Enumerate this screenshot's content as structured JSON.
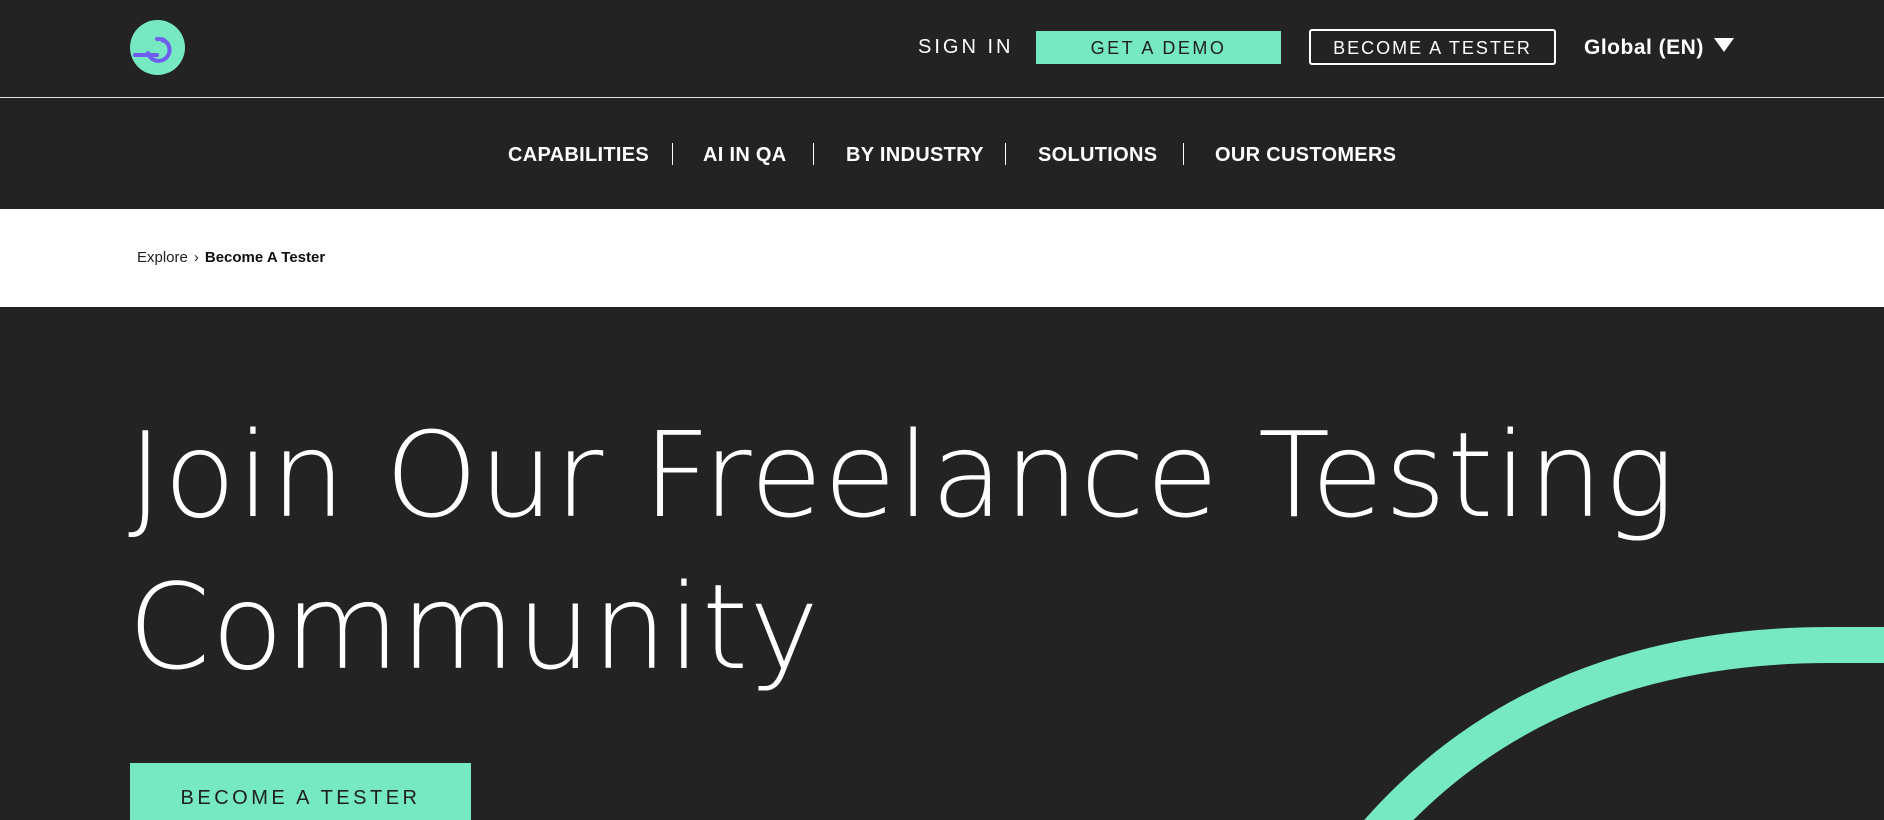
{
  "header": {
    "logo_icon": "applause-logo-icon",
    "sign_in": "SIGN IN",
    "get_demo": "GET A DEMO",
    "become_tester": "BECOME A TESTER",
    "language": "Global (EN)",
    "language_icon": "caret-down-icon"
  },
  "nav": {
    "items": [
      {
        "label": "CAPABILITIES"
      },
      {
        "label": "AI IN QA"
      },
      {
        "label": "BY INDUSTRY"
      },
      {
        "label": "SOLUTIONS"
      },
      {
        "label": "OUR CUSTOMERS"
      }
    ]
  },
  "breadcrumb": {
    "parent": "Explore",
    "separator": "›",
    "current": "Become A Tester"
  },
  "hero": {
    "title_line1": "Join Our Freelance Testing",
    "title_line2": "Community",
    "cta": "BECOME A TESTER"
  },
  "colors": {
    "background": "#232323",
    "accent": "#76e8c2",
    "logo_mark": "#6f5df0",
    "text": "#ffffff"
  }
}
